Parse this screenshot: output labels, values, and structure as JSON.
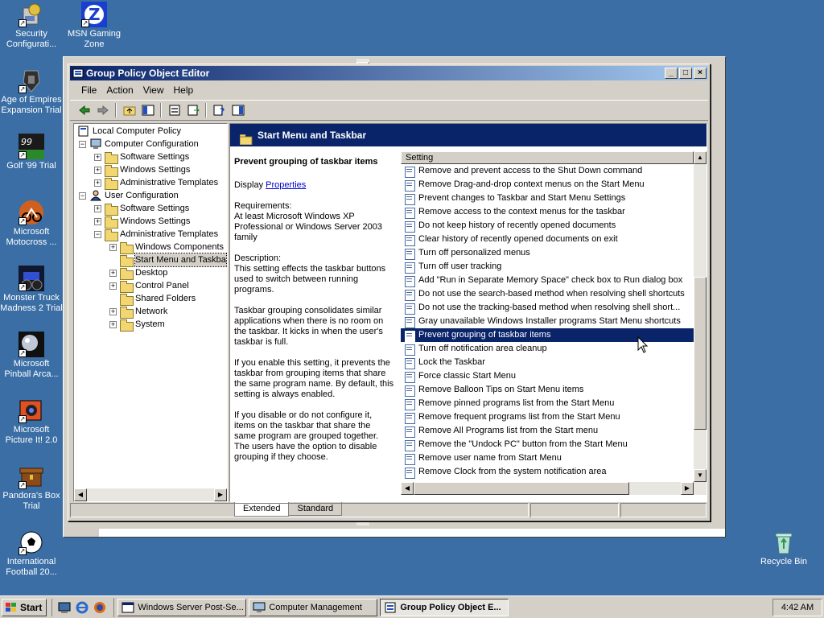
{
  "desktop": {
    "icons": [
      {
        "label": "Security Configurati...",
        "icon": "security-config-icon"
      },
      {
        "label": "MSN Gaming Zone",
        "icon": "msn-gaming-zone-icon"
      },
      {
        "label": "Age of Empires Expansion Trial",
        "icon": "age-of-empires-icon"
      },
      {
        "label": "Golf '99 Trial",
        "icon": "golf-99-icon"
      },
      {
        "label": "Microsoft Motocross ...",
        "icon": "motocross-icon"
      },
      {
        "label": "Monster Truck Madness 2 Trial",
        "icon": "monster-truck-icon"
      },
      {
        "label": "Microsoft Pinball Arca...",
        "icon": "pinball-icon"
      },
      {
        "label": "Microsoft Picture It! 2.0",
        "icon": "picture-it-icon"
      },
      {
        "label": "Pandora's Box Trial",
        "icon": "pandoras-box-icon"
      },
      {
        "label": "International Football 20...",
        "icon": "football-icon"
      },
      {
        "label": "Recycle Bin",
        "icon": "recycle-bin-icon"
      }
    ]
  },
  "window": {
    "title": "Group Policy Object Editor",
    "menu": [
      "File",
      "Action",
      "View",
      "Help"
    ],
    "title_buttons": [
      "_",
      "□",
      "×"
    ]
  },
  "tree": {
    "nodes": [
      {
        "label": "Local Computer Policy",
        "expander": ""
      },
      {
        "label": "Computer Configuration",
        "expander": "−"
      },
      {
        "label": "Software Settings",
        "expander": "+"
      },
      {
        "label": "Windows Settings",
        "expander": "+"
      },
      {
        "label": "Administrative Templates",
        "expander": "+"
      },
      {
        "label": "User Configuration",
        "expander": "−"
      },
      {
        "label": "Software Settings",
        "expander": "+"
      },
      {
        "label": "Windows Settings",
        "expander": "+"
      },
      {
        "label": "Administrative Templates",
        "expander": "−"
      },
      {
        "label": "Windows Components",
        "expander": "+"
      },
      {
        "label": "Start Menu and Taskba",
        "expander": ""
      },
      {
        "label": "Desktop",
        "expander": "+"
      },
      {
        "label": "Control Panel",
        "expander": "+"
      },
      {
        "label": "Shared Folders",
        "expander": ""
      },
      {
        "label": "Network",
        "expander": "+"
      },
      {
        "label": "System",
        "expander": "+"
      }
    ]
  },
  "detail": {
    "header": "Start Menu and Taskbar",
    "setting_title": "Prevent grouping of taskbar items",
    "display_prefix": "Display ",
    "display_link": "Properties",
    "requirements": "Requirements:\nAt least Microsoft Windows XP Professional or Windows Server 2003 family",
    "description": "Description:\nThis setting effects the taskbar buttons used to switch between running programs.",
    "para2": "Taskbar grouping consolidates similar applications when there is no room on the taskbar. It kicks in when the user's taskbar is full.",
    "para3": "If you enable this setting, it prevents the taskbar from grouping items that share the same program name. By default, this setting is always enabled.",
    "para4": "If you disable or do not configure it, items on the taskbar that share the same program are grouped together. The users have the option to disable grouping if they choose."
  },
  "settings_list": {
    "column_header": "Setting",
    "selected_index": 12,
    "rows": [
      "Remove and prevent access to the Shut Down command",
      "Remove Drag-and-drop context menus on the Start Menu",
      "Prevent changes to Taskbar and Start Menu Settings",
      "Remove access to the context menus for the taskbar",
      "Do not keep history of recently opened documents",
      "Clear history of recently opened documents on exit",
      "Turn off personalized menus",
      "Turn off user tracking",
      "Add \"Run in Separate Memory Space\" check box to Run dialog box",
      "Do not use the search-based method when resolving shell shortcuts",
      "Do not use the tracking-based method when resolving shell short...",
      "Gray unavailable Windows Installer programs Start Menu shortcuts",
      "Prevent grouping of taskbar items",
      "Turn off notification area cleanup",
      "Lock the Taskbar",
      "Force classic Start Menu",
      "Remove Balloon Tips on Start Menu items",
      "Remove pinned programs list from the Start Menu",
      "Remove frequent programs list from the Start Menu",
      "Remove All Programs list from the Start menu",
      "Remove the \"Undock PC\" button from the Start Menu",
      "Remove user name from Start Menu",
      "Remove Clock from the system notification area"
    ]
  },
  "tabs": [
    "Extended",
    "Standard"
  ],
  "taskbar": {
    "start_label": "Start",
    "tasks": [
      {
        "label": "Windows Server Post-Se...",
        "active": false
      },
      {
        "label": "Computer Management",
        "active": false
      },
      {
        "label": "Group Policy Object E...",
        "active": true
      }
    ],
    "clock": "4:42 AM"
  },
  "colors": {
    "desktop": "#3a6ea5",
    "title_active": "#0a246a",
    "selection": "#0a246a",
    "face": "#d4d0c8"
  }
}
